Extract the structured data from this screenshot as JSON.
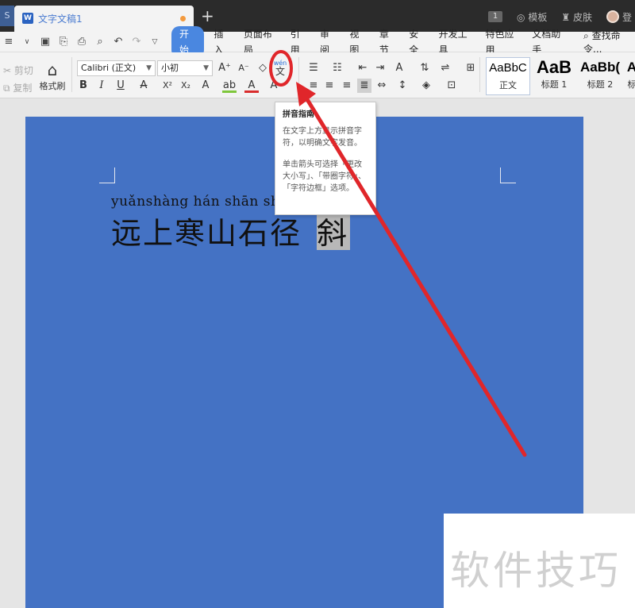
{
  "titlebar": {
    "app_corner": "S",
    "doc_tab_icon": "W",
    "doc_tab_title": "文字文稿1",
    "new_tab": "+",
    "unread_badge": "1",
    "template_label": "模板",
    "skin_label": "皮肤",
    "user_initial": "登"
  },
  "menubar": {
    "items": [
      "开始",
      "插入",
      "页面布局",
      "引用",
      "审阅",
      "视图",
      "章节",
      "安全",
      "开发工具",
      "特色应用",
      "文档助手"
    ],
    "active_index": 0,
    "search_label": "查找命令..."
  },
  "ribbon": {
    "cut_label": "剪切",
    "copy_label": "复制",
    "format_painter_label": "格式刷",
    "font_name": "Calibri (正文)",
    "font_size": "小初",
    "pinyin_icon_top": "wén",
    "pinyin_icon_bottom": "文",
    "styles": [
      {
        "sample": "AaBbC",
        "label": "正文"
      },
      {
        "sample": "AaB",
        "label": "标题 1"
      },
      {
        "sample": "AaBb(",
        "label": "标题 2"
      },
      {
        "sample": "A",
        "label": "标"
      }
    ]
  },
  "tooltip": {
    "title": "拼音指南",
    "desc1": "在文字上方显示拼音字符，以明确文字发音。",
    "desc2": "单击箭头可选择「更改大小写」、「带圈字符」、「字符边框」选项。"
  },
  "document": {
    "pinyin": "yuǎnshàng hán  shān  shí",
    "hanzi": "远上寒山石径",
    "selected_char": "斜"
  },
  "watermark": "软件技巧",
  "annotation_color": "#e0262a",
  "page_color": "#4472c4"
}
